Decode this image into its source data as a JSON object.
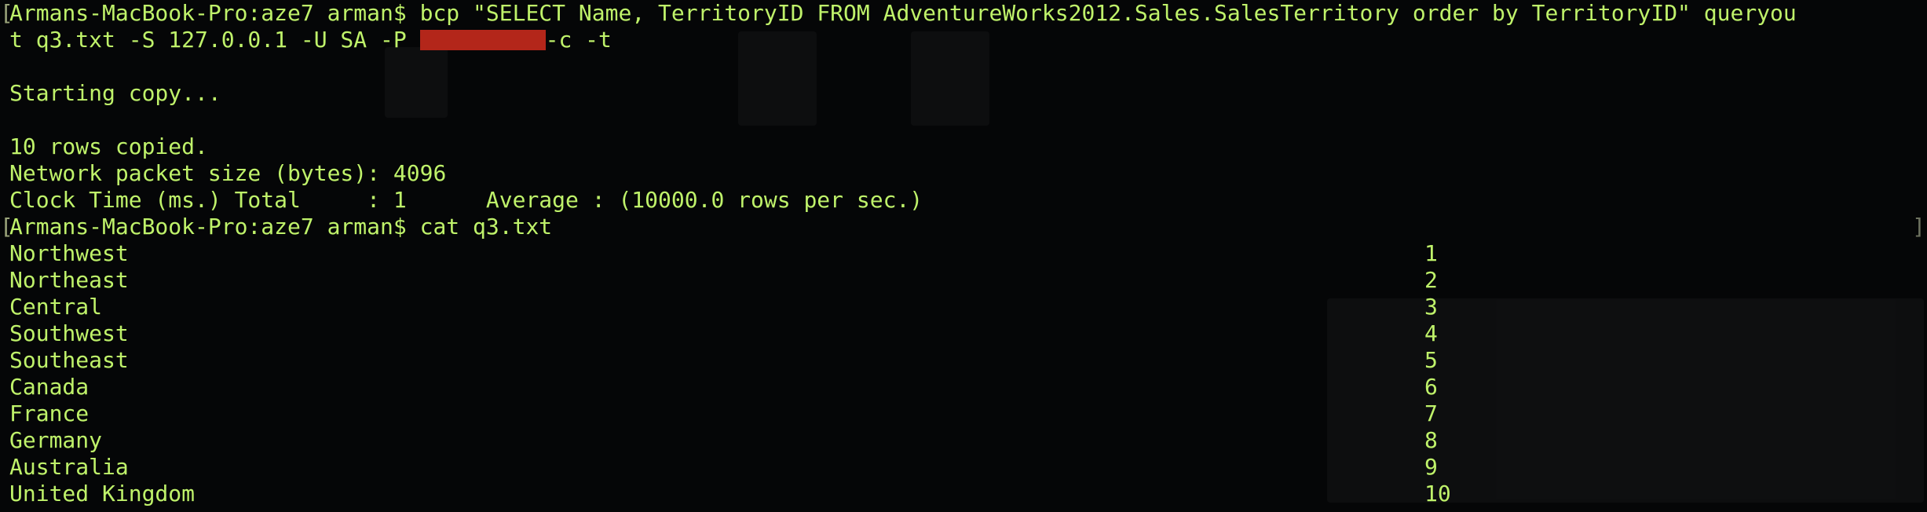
{
  "window": {
    "title": ""
  },
  "bcp": {
    "prompt": "Armans-MacBook-Pro:aze7 arman$ ",
    "command_part1": "bcp \"SELECT Name, TerritoryID FROM AdventureWorks2012.Sales.SalesTerritory order by TerritoryID\" queryou",
    "command_part2_a": "t q3.txt -S 127.0.0.1 -U SA -P ",
    "command_part2_b": "-c -t"
  },
  "output": {
    "starting": "Starting copy...",
    "rows_copied": "10 rows copied.",
    "packet_size": "Network packet size (bytes): 4096",
    "clock_time": "Clock Time (ms.) Total     : 1      Average : (10000.0 rows per sec.)"
  },
  "cat": {
    "prompt": "Armans-MacBook-Pro:aze7 arman$ ",
    "command": "cat q3.txt"
  },
  "rows": [
    {
      "name": "Northwest",
      "id": "1"
    },
    {
      "name": "Northeast",
      "id": "2"
    },
    {
      "name": "Central",
      "id": "3"
    },
    {
      "name": "Southwest",
      "id": "4"
    },
    {
      "name": "Southeast",
      "id": "5"
    },
    {
      "name": "Canada",
      "id": "6"
    },
    {
      "name": "France",
      "id": "7"
    },
    {
      "name": "Germany",
      "id": "8"
    },
    {
      "name": "Australia",
      "id": "9"
    },
    {
      "name": "United Kingdom",
      "id": "10"
    }
  ],
  "colors": {
    "background": "#050607",
    "text": "#bff26a",
    "redaction": "#b3261a"
  }
}
